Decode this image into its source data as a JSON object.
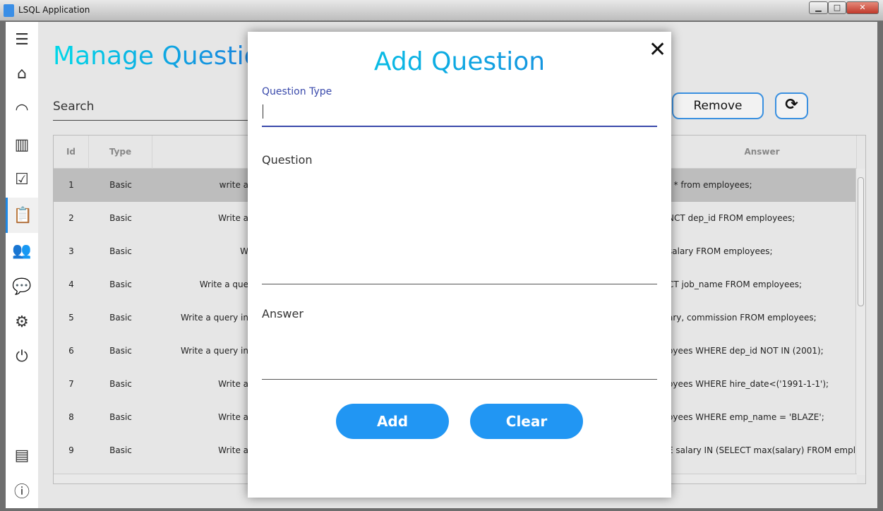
{
  "window": {
    "title": "LSQL Application",
    "minimize": "▁",
    "maximize": "□",
    "close": "✕"
  },
  "sidebar": {
    "items": [
      {
        "name": "menu",
        "glyph": "☰"
      },
      {
        "name": "home",
        "glyph": "⌂"
      },
      {
        "name": "wifi",
        "glyph": "◠"
      },
      {
        "name": "chart",
        "glyph": "▥"
      },
      {
        "name": "checklist",
        "glyph": "☑"
      },
      {
        "name": "questions",
        "glyph": "📋"
      },
      {
        "name": "users",
        "glyph": "👥"
      },
      {
        "name": "chat",
        "glyph": "💬"
      },
      {
        "name": "settings",
        "glyph": "⚙"
      },
      {
        "name": "power",
        "glyph": "⏻"
      },
      {
        "name": "dashboard",
        "glyph": "▤"
      },
      {
        "name": "info",
        "glyph": "ⓘ"
      }
    ],
    "active": "questions",
    "accent": "#1e88e5"
  },
  "page": {
    "title": "Manage Question",
    "search_label": "Search",
    "remove_label": "Remove",
    "refresh_glyph": "⟳"
  },
  "table": {
    "columns": [
      "Id",
      "Type",
      "",
      "Answer"
    ],
    "rows": [
      {
        "id": "1",
        "type": "Basic",
        "question": "write a",
        "answer": "t * from employees;"
      },
      {
        "id": "2",
        "type": "Basic",
        "question": "Write a",
        "answer": "NCT dep_id FROM employees;"
      },
      {
        "id": "3",
        "type": "Basic",
        "question": "W",
        "answer": "salary FROM employees;"
      },
      {
        "id": "4",
        "type": "Basic",
        "question": "Write a que",
        "answer": "CT job_name FROM employees;"
      },
      {
        "id": "5",
        "type": "Basic",
        "question": "Write a query in",
        "answer": "ary, commission FROM employees;"
      },
      {
        "id": "6",
        "type": "Basic",
        "question": "Write a query in",
        "answer": "oyees WHERE dep_id NOT IN (2001);"
      },
      {
        "id": "7",
        "type": "Basic",
        "question": "Write a",
        "answer": "oyees WHERE hire_date<('1991-1-1');"
      },
      {
        "id": "8",
        "type": "Basic",
        "question": "Write a",
        "answer": "oyees WHERE emp_name = 'BLAZE';"
      },
      {
        "id": "9",
        "type": "Basic",
        "question": "Write a",
        "answer": "E salary IN (SELECT max(salary) FROM employ..."
      }
    ],
    "selected_row": "1"
  },
  "dialog": {
    "title": "Add Question",
    "close_glyph": "✕",
    "question_type_label": "Question Type",
    "question_type_value": "",
    "question_label": "Question",
    "question_value": "",
    "answer_label": "Answer",
    "answer_value": "",
    "add_label": "Add",
    "clear_label": "Clear",
    "button_color": "#2196f3"
  }
}
